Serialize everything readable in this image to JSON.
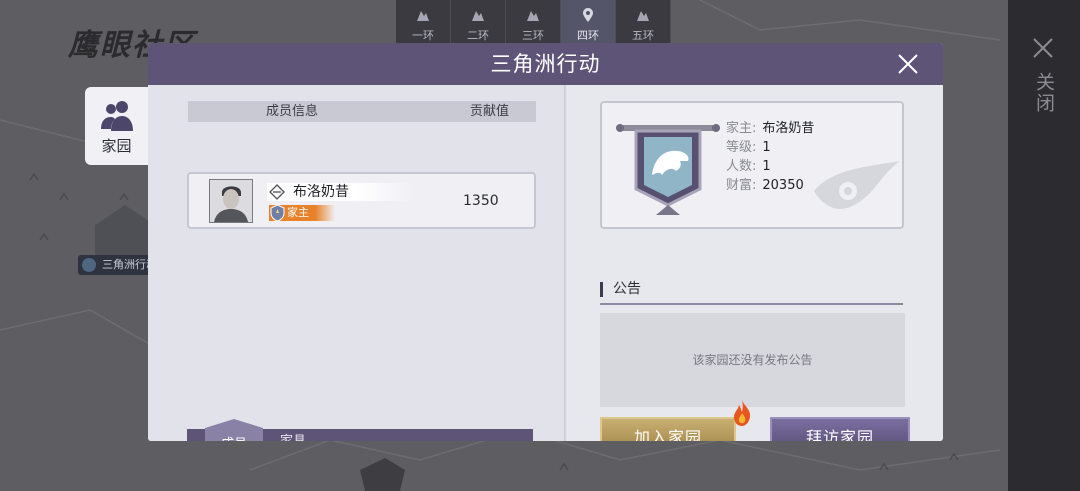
{
  "background": {
    "title": "鹰眼社区",
    "ring_tabs": [
      {
        "label": "一环",
        "icon": "map-icon",
        "active": false
      },
      {
        "label": "二环",
        "icon": "map-icon",
        "active": false
      },
      {
        "label": "三环",
        "icon": "map-icon",
        "active": false
      },
      {
        "label": "四环",
        "icon": "map-pin-icon",
        "active": true
      },
      {
        "label": "五环",
        "icon": "map-icon",
        "active": false
      }
    ],
    "map_marker": "三角洲行动"
  },
  "side": {
    "close_label": "关闭"
  },
  "nav": {
    "home_label": "家园",
    "icon": "people-icon"
  },
  "dialog": {
    "title": "三角洲行动",
    "members_table": {
      "header_info": "成员信息",
      "header_contrib": "贡献值",
      "rows": [
        {
          "name": "布洛奶昔",
          "role": "家主",
          "contribution": "1350"
        }
      ]
    },
    "tabs": {
      "members": "成员",
      "furniture": "家具"
    },
    "info": {
      "owner_label": "家主:",
      "owner_value": "布洛奶昔",
      "level_label": "等级:",
      "level_value": "1",
      "count_label": "人数:",
      "count_value": "1",
      "wealth_label": "财富:",
      "wealth_value": "20350"
    },
    "announcement": {
      "title": "公告",
      "empty_text": "该家园还没有发布公告"
    },
    "buttons": {
      "join": "加入家园",
      "visit": "拜访家园"
    },
    "colors": {
      "header": "#5d5477",
      "join": "#b39a5c",
      "visit": "#5d5477",
      "role_badge": "#e7822a",
      "emblem": "#6e7fa8"
    }
  }
}
